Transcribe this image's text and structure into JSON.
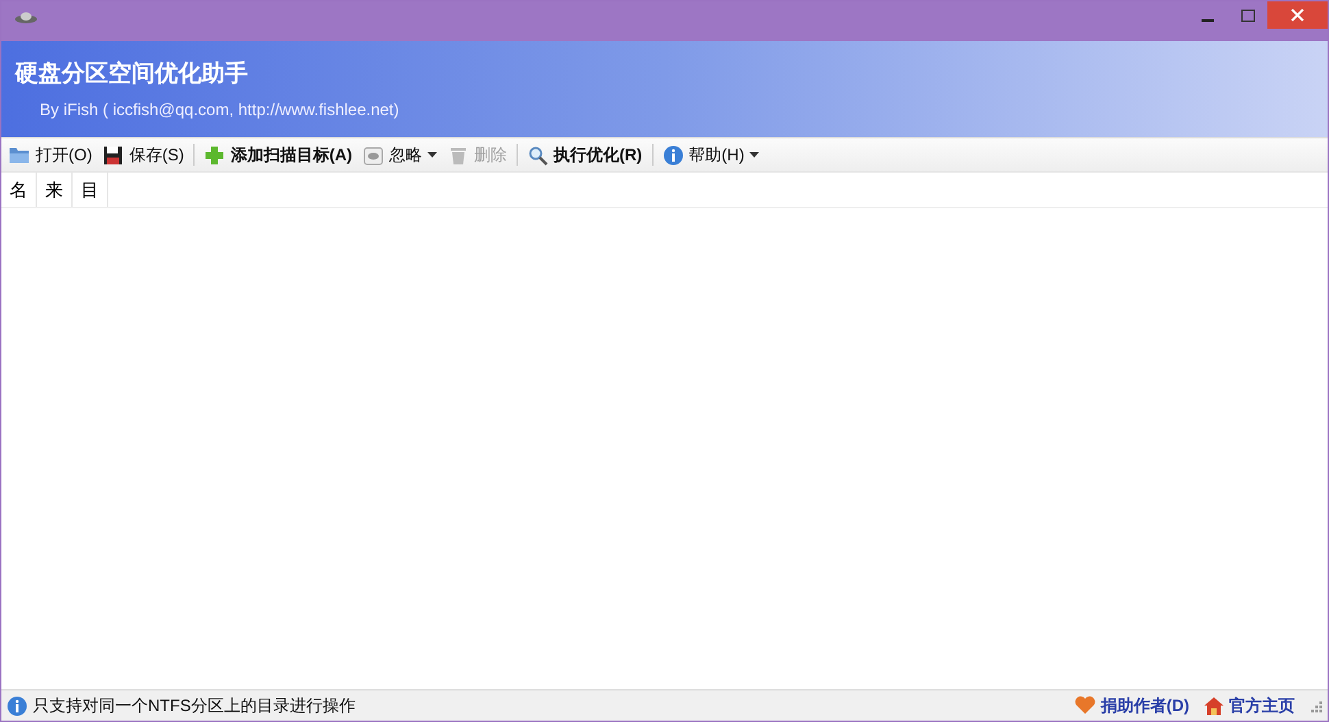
{
  "app": {
    "title": "硬盘分区空间优化助手",
    "subtitle": "By iFish ( iccfish@qq.com, http://www.fishlee.net)"
  },
  "toolbar": [
    {
      "kind": "button",
      "label": "打开(O)",
      "bold": false,
      "disabled": false,
      "dropdown": false
    },
    {
      "kind": "button",
      "label": "保存(S)",
      "bold": false,
      "disabled": false,
      "dropdown": false
    },
    {
      "kind": "separator"
    },
    {
      "kind": "button",
      "label": "添加扫描目标(A)",
      "bold": true,
      "disabled": false,
      "dropdown": false
    },
    {
      "kind": "button",
      "label": "忽略",
      "bold": false,
      "disabled": false,
      "dropdown": true
    },
    {
      "kind": "button",
      "label": "删除",
      "bold": false,
      "disabled": true,
      "dropdown": false
    },
    {
      "kind": "separator"
    },
    {
      "kind": "button",
      "label": "执行优化(R)",
      "bold": true,
      "disabled": false,
      "dropdown": false
    },
    {
      "kind": "separator"
    },
    {
      "kind": "button",
      "label": "帮助(H)",
      "bold": false,
      "disabled": false,
      "dropdown": true
    }
  ],
  "table": {
    "columns": [
      "名",
      "来",
      "目"
    ]
  },
  "status_bar": {
    "message": "只支持对同一个NTFS分区上的目录进行操作",
    "links": [
      {
        "label": "捐助作者(D)"
      },
      {
        "label": "官方主页"
      }
    ]
  }
}
